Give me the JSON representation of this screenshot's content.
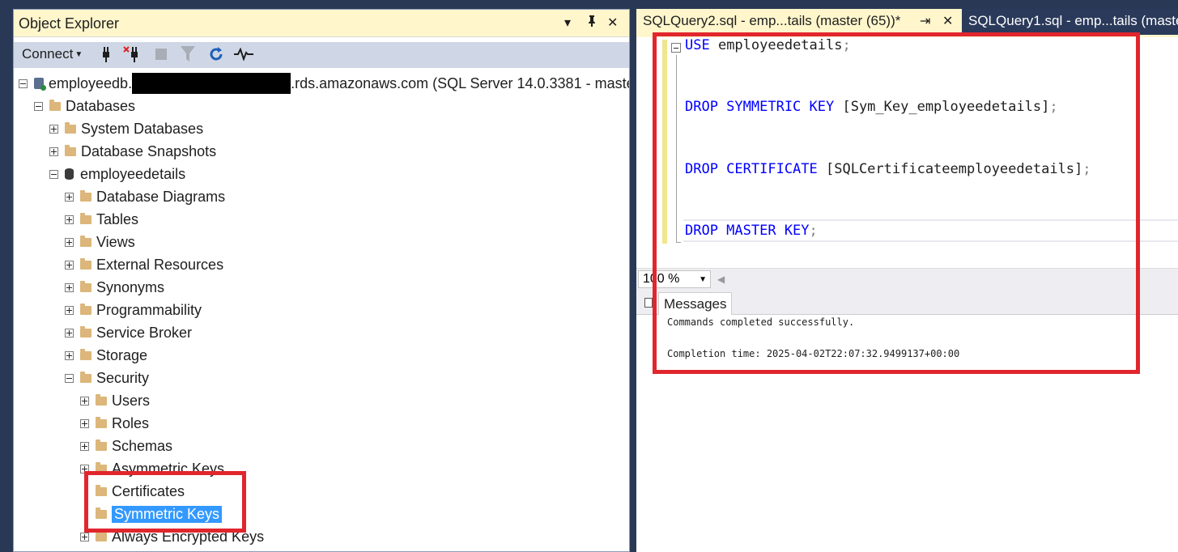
{
  "object_explorer": {
    "title": "Object Explorer",
    "title_controls": {
      "dropdown": "▾",
      "pin": "📌",
      "close": "✕"
    },
    "toolbar": {
      "connect_label": "Connect",
      "connect_caret": "▼"
    },
    "server_node": {
      "prefix": "employeedb.",
      "suffix": ".rds.amazonaws.com (SQL Server 14.0.3381 - master"
    },
    "tree": [
      {
        "label": "Databases",
        "expander": "minus",
        "icon": "folder"
      },
      {
        "label": "System Databases",
        "expander": "plus",
        "icon": "folder"
      },
      {
        "label": "Database Snapshots",
        "expander": "plus",
        "icon": "folder"
      },
      {
        "label": "employeedetails",
        "expander": "minus",
        "icon": "database"
      },
      {
        "label": "Database Diagrams",
        "expander": "plus",
        "icon": "folder"
      },
      {
        "label": "Tables",
        "expander": "plus",
        "icon": "folder"
      },
      {
        "label": "Views",
        "expander": "plus",
        "icon": "folder"
      },
      {
        "label": "External Resources",
        "expander": "plus",
        "icon": "folder"
      },
      {
        "label": "Synonyms",
        "expander": "plus",
        "icon": "folder"
      },
      {
        "label": "Programmability",
        "expander": "plus",
        "icon": "folder"
      },
      {
        "label": "Service Broker",
        "expander": "plus",
        "icon": "folder"
      },
      {
        "label": "Storage",
        "expander": "plus",
        "icon": "folder"
      },
      {
        "label": "Security",
        "expander": "minus",
        "icon": "folder"
      },
      {
        "label": "Users",
        "expander": "plus",
        "icon": "folder"
      },
      {
        "label": "Roles",
        "expander": "plus",
        "icon": "folder"
      },
      {
        "label": "Schemas",
        "expander": "plus",
        "icon": "folder"
      },
      {
        "label": "Asymmetric Keys",
        "expander": "plus",
        "icon": "folder"
      },
      {
        "label": "Certificates",
        "expander": "none",
        "icon": "folder"
      },
      {
        "label": "Symmetric Keys",
        "expander": "none",
        "icon": "folder",
        "selected": true
      },
      {
        "label": "Always Encrypted Keys",
        "expander": "plus",
        "icon": "folder"
      }
    ]
  },
  "tabs": [
    {
      "label": "SQLQuery2.sql - emp...tails (master (65))*",
      "active": true
    },
    {
      "label": "SQLQuery1.sql - emp...tails (master",
      "active": false
    }
  ],
  "tab_controls": {
    "pin": "⇥",
    "close": "✕"
  },
  "editor": {
    "collapse_glyph": "−",
    "lines": [
      {
        "kw": "USE",
        "rest": " employeedetails",
        "end": ";"
      },
      {
        "kw": "DROP SYMMETRIC KEY",
        "rest": " [Sym_Key_employeedetails]",
        "end": ";"
      },
      {
        "kw": "DROP CERTIFICATE",
        "rest": " [SQLCertificateemployeedetails]",
        "end": ";"
      },
      {
        "kw": "DROP MASTER KEY",
        "rest": "",
        "end": ";"
      }
    ]
  },
  "zoom": {
    "value": "100 %",
    "caret": "▼",
    "scroll_arrow": "◀"
  },
  "messages": {
    "tab_label": "Messages",
    "line1": "Commands completed successfully.",
    "line2": "Completion time: 2025-04-02T22:07:32.9499137+00:00"
  },
  "colors": {
    "highlight_red": "#e1262d",
    "keyword_blue": "#0000ff",
    "selection_blue": "#3399ff",
    "panel_yellow": "#fff6cc"
  }
}
